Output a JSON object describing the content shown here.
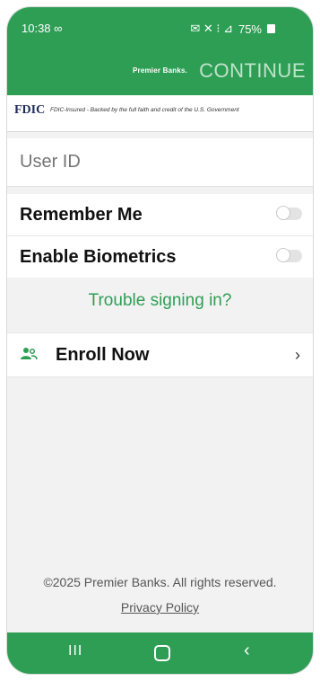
{
  "status": {
    "time": "10:38 ∞",
    "icons": "✉ ✕ ⁝ ⊿",
    "battery": "75%"
  },
  "header": {
    "brand": "Premier Banks.",
    "continue_label": "CONTINUE"
  },
  "fdic": {
    "logo": "FDIC",
    "text": "FDIC-Insured - Backed by the full faith and credit of the U.S. Government"
  },
  "login": {
    "userid_placeholder": "User ID"
  },
  "settings": {
    "remember_label": "Remember Me",
    "biometrics_label": "Enable Biometrics"
  },
  "trouble_label": "Trouble signing in?",
  "enroll": {
    "label": "Enroll Now",
    "chevron": "›"
  },
  "footer": {
    "copyright": "©2025 Premier Banks. All rights reserved.",
    "privacy_label": "Privacy Policy"
  },
  "nav": {
    "recents": "III",
    "back": "‹"
  },
  "colors": {
    "brand_green": "#2e9e55",
    "continue_disabled": "#bfe3cb",
    "fdic_navy": "#1e2b57"
  }
}
